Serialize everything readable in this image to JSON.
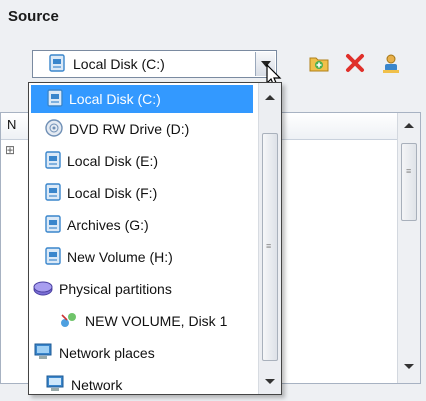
{
  "source": {
    "title": "Source",
    "combo_value": "Local Disk (C:)"
  },
  "toolbar": {
    "icons": [
      "add-folder-icon",
      "delete-icon",
      "user-icon"
    ]
  },
  "background_panel": {
    "header_partial": "N",
    "tree_glyph": "⊞",
    "partial_text": "s"
  },
  "dropdown": {
    "items": [
      {
        "label": "Local Disk (C:)",
        "icon": "drive-icon",
        "selected": true
      },
      {
        "label": "DVD RW Drive (D:)",
        "icon": "dvd-icon",
        "selected": false
      },
      {
        "label": "Local Disk (E:)",
        "icon": "drive-icon",
        "selected": false
      },
      {
        "label": "Local Disk (F:)",
        "icon": "drive-icon",
        "selected": false
      },
      {
        "label": "Archives (G:)",
        "icon": "drive-icon",
        "selected": false
      },
      {
        "label": "New Volume (H:)",
        "icon": "drive-icon",
        "selected": false
      },
      {
        "label": "Physical partitions",
        "icon": "physical-disk-icon",
        "selected": false
      },
      {
        "label": "NEW VOLUME, Disk 1",
        "icon": "partition-icon",
        "selected": false
      },
      {
        "label": "Network places",
        "icon": "network-places-icon",
        "selected": false
      },
      {
        "label": "Network",
        "icon": "network-icon",
        "selected": false
      }
    ]
  },
  "colors": {
    "selection": "#3399ff",
    "background": "#eef0f3"
  }
}
